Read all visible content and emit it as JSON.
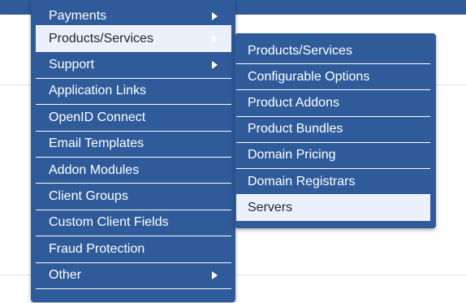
{
  "main_menu": {
    "items": [
      {
        "label": "Payments",
        "has_submenu": true
      },
      {
        "label": "Products/Services",
        "has_submenu": true,
        "active": true
      },
      {
        "label": "Support",
        "has_submenu": true
      },
      {
        "label": "Application Links"
      },
      {
        "label": "OpenID Connect"
      },
      {
        "label": "Email Templates"
      },
      {
        "label": "Addon Modules"
      },
      {
        "label": "Client Groups"
      },
      {
        "label": "Custom Client Fields"
      },
      {
        "label": "Fraud Protection"
      },
      {
        "label": "Other",
        "has_submenu": true
      }
    ]
  },
  "submenu": {
    "items": [
      {
        "label": "Products/Services"
      },
      {
        "label": "Configurable Options"
      },
      {
        "label": "Product Addons"
      },
      {
        "label": "Product Bundles"
      },
      {
        "label": "Domain Pricing"
      },
      {
        "label": "Domain Registrars"
      },
      {
        "label": "Servers",
        "active": true
      }
    ]
  },
  "colors": {
    "menu_bg": "#2f5b9a",
    "active_bg": "#ebf0fa",
    "text": "#ffffff",
    "active_text": "#1e2733"
  }
}
